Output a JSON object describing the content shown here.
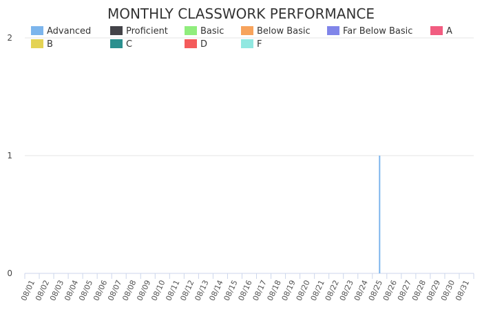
{
  "chart_data": {
    "type": "bar",
    "title": "MONTHLY CLASSWORK PERFORMANCE",
    "xlabel": "",
    "ylabel": "",
    "ylim": [
      0,
      2
    ],
    "yticks": [
      "0",
      "1",
      "2"
    ],
    "grid": true,
    "legend_position": "top",
    "categories": [
      "08/01",
      "08/02",
      "08/03",
      "08/04",
      "08/05",
      "08/06",
      "08/07",
      "08/08",
      "08/09",
      "08/10",
      "08/11",
      "08/12",
      "08/13",
      "08/14",
      "08/15",
      "08/16",
      "08/17",
      "08/18",
      "08/19",
      "08/20",
      "08/21",
      "08/22",
      "08/23",
      "08/24",
      "08/25",
      "08/26",
      "08/27",
      "08/28",
      "08/29",
      "08/30",
      "08/31"
    ],
    "series": [
      {
        "name": "Advanced",
        "color": "#7cb5ec",
        "values": [
          0,
          0,
          0,
          0,
          0,
          0,
          0,
          0,
          0,
          0,
          0,
          0,
          0,
          0,
          0,
          0,
          0,
          0,
          0,
          0,
          0,
          0,
          0,
          0,
          1,
          0,
          0,
          0,
          0,
          0,
          0
        ]
      },
      {
        "name": "Proficient",
        "color": "#434348",
        "values": [
          0,
          0,
          0,
          0,
          0,
          0,
          0,
          0,
          0,
          0,
          0,
          0,
          0,
          0,
          0,
          0,
          0,
          0,
          0,
          0,
          0,
          0,
          0,
          0,
          0,
          0,
          0,
          0,
          0,
          0,
          0
        ]
      },
      {
        "name": "Basic",
        "color": "#90ed7d",
        "values": [
          0,
          0,
          0,
          0,
          0,
          0,
          0,
          0,
          0,
          0,
          0,
          0,
          0,
          0,
          0,
          0,
          0,
          0,
          0,
          0,
          0,
          0,
          0,
          0,
          0,
          0,
          0,
          0,
          0,
          0,
          0
        ]
      },
      {
        "name": "Below Basic",
        "color": "#f7a35c",
        "values": [
          0,
          0,
          0,
          0,
          0,
          0,
          0,
          0,
          0,
          0,
          0,
          0,
          0,
          0,
          0,
          0,
          0,
          0,
          0,
          0,
          0,
          0,
          0,
          0,
          0,
          0,
          0,
          0,
          0,
          0,
          0
        ]
      },
      {
        "name": "Far Below Basic",
        "color": "#8085e9",
        "values": [
          0,
          0,
          0,
          0,
          0,
          0,
          0,
          0,
          0,
          0,
          0,
          0,
          0,
          0,
          0,
          0,
          0,
          0,
          0,
          0,
          0,
          0,
          0,
          0,
          0,
          0,
          0,
          0,
          0,
          0,
          0
        ]
      },
      {
        "name": "A",
        "color": "#f15c80",
        "values": [
          0,
          0,
          0,
          0,
          0,
          0,
          0,
          0,
          0,
          0,
          0,
          0,
          0,
          0,
          0,
          0,
          0,
          0,
          0,
          0,
          0,
          0,
          0,
          0,
          0,
          0,
          0,
          0,
          0,
          0,
          0
        ]
      },
      {
        "name": "B",
        "color": "#e4d354",
        "values": [
          0,
          0,
          0,
          0,
          0,
          0,
          0,
          0,
          0,
          0,
          0,
          0,
          0,
          0,
          0,
          0,
          0,
          0,
          0,
          0,
          0,
          0,
          0,
          0,
          0,
          0,
          0,
          0,
          0,
          0,
          0
        ]
      },
      {
        "name": "C",
        "color": "#2b908f",
        "values": [
          0,
          0,
          0,
          0,
          0,
          0,
          0,
          0,
          0,
          0,
          0,
          0,
          0,
          0,
          0,
          0,
          0,
          0,
          0,
          0,
          0,
          0,
          0,
          0,
          0,
          0,
          0,
          0,
          0,
          0,
          0
        ]
      },
      {
        "name": "D",
        "color": "#f45b5b",
        "values": [
          0,
          0,
          0,
          0,
          0,
          0,
          0,
          0,
          0,
          0,
          0,
          0,
          0,
          0,
          0,
          0,
          0,
          0,
          0,
          0,
          0,
          0,
          0,
          0,
          0,
          0,
          0,
          0,
          0,
          0,
          0
        ]
      },
      {
        "name": "F",
        "color": "#91e8e1",
        "values": [
          0,
          0,
          0,
          0,
          0,
          0,
          0,
          0,
          0,
          0,
          0,
          0,
          0,
          0,
          0,
          0,
          0,
          0,
          0,
          0,
          0,
          0,
          0,
          0,
          0,
          0,
          0,
          0,
          0,
          0,
          0
        ]
      }
    ]
  }
}
